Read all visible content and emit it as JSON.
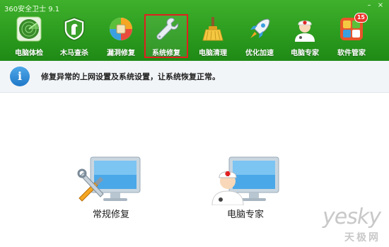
{
  "app": {
    "title": "360安全卫士 9.1"
  },
  "toolbar": {
    "items": [
      {
        "label": "电脑体检",
        "icon": "radar-icon"
      },
      {
        "label": "木马查杀",
        "icon": "horse-shield-icon"
      },
      {
        "label": "漏洞修复",
        "icon": "patch-ball-icon"
      },
      {
        "label": "系统修复",
        "icon": "wrench-icon",
        "active": true
      },
      {
        "label": "电脑清理",
        "icon": "broom-icon"
      },
      {
        "label": "优化加速",
        "icon": "rocket-icon"
      },
      {
        "label": "电脑专家",
        "icon": "doctor-icon"
      },
      {
        "label": "软件管家",
        "icon": "apps-grid-icon",
        "badge": "15"
      }
    ]
  },
  "info": {
    "message": "修复异常的上网设置及系统设置，让系统恢复正常。"
  },
  "main": {
    "options": [
      {
        "label": "常规修复",
        "icon": "monitor-tools-icon"
      },
      {
        "label": "电脑专家",
        "icon": "monitor-doctor-icon"
      }
    ]
  },
  "watermark": {
    "line1": "yesky",
    "line2": "天极网"
  },
  "colors": {
    "topbar": "#2c9c1f",
    "active_border": "#e02020",
    "info_icon": "#1f78c8"
  }
}
